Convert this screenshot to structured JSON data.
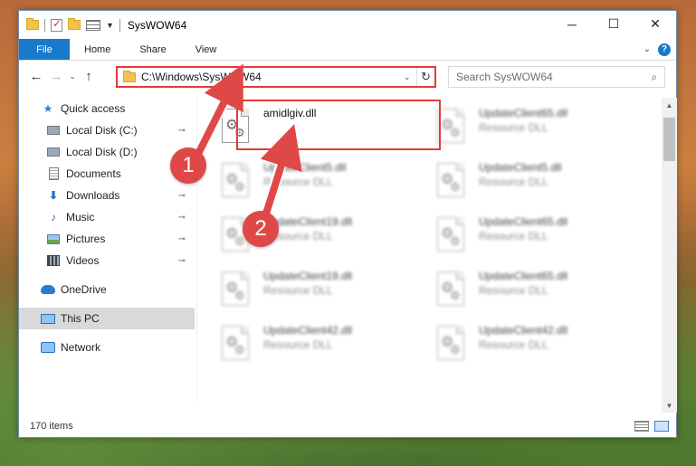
{
  "window": {
    "title": "SysWOW64",
    "controls": {
      "minimize": "─",
      "maximize": "☐",
      "close": "✕"
    }
  },
  "ribbon": {
    "tabs": [
      "File",
      "Home",
      "Share",
      "View"
    ],
    "expand_glyph": "⌄",
    "help_glyph": "?"
  },
  "address": {
    "back": "←",
    "forward": "→",
    "recent": "⌄",
    "up": "↑",
    "path": "C:\\Windows\\SysWOW64",
    "dropdown": "⌄",
    "refresh": "↻",
    "search_placeholder": "Search SysWOW64",
    "search_icon": "⌕"
  },
  "sidebar": {
    "items": [
      {
        "label": "Quick access",
        "icon": "star-icon"
      },
      {
        "label": "Local Disk (C:)",
        "icon": "disk-icon",
        "pinned": true
      },
      {
        "label": "Local Disk (D:)",
        "icon": "disk-icon"
      },
      {
        "label": "Documents",
        "icon": "documents-icon"
      },
      {
        "label": "Downloads",
        "icon": "downloads-icon",
        "pinned": true
      },
      {
        "label": "Music",
        "icon": "music-icon",
        "pinned": true
      },
      {
        "label": "Pictures",
        "icon": "pictures-icon",
        "pinned": true
      },
      {
        "label": "Videos",
        "icon": "videos-icon",
        "pinned": true
      },
      {
        "label": "OneDrive",
        "icon": "onedrive-icon"
      },
      {
        "label": "This PC",
        "icon": "computer-icon",
        "selected": true
      },
      {
        "label": "Network",
        "icon": "network-icon"
      }
    ],
    "pin_glyph": "📌"
  },
  "files": [
    {
      "name": "amidlgiv.dll",
      "type": ""
    },
    {
      "name": "UpdateClient65.dll",
      "type": "Resource DLL"
    },
    {
      "name": "UpdateClient5.dll",
      "type": "Resource DLL"
    },
    {
      "name": "UpdateClient5.dll",
      "type": "Resource DLL"
    },
    {
      "name": "UpdateClient19.dll",
      "type": "Resource DLL"
    },
    {
      "name": "UpdateClient65.dll",
      "type": "Resource DLL"
    },
    {
      "name": "UpdateClient19.dll",
      "type": "Resource DLL"
    },
    {
      "name": "UpdateClient65.dll",
      "type": "Resource DLL"
    },
    {
      "name": "UpdateClient42.dll",
      "type": "Resource DLL"
    },
    {
      "name": "UpdateClient42.dll",
      "type": "Resource DLL"
    }
  ],
  "scrollbar": {
    "up": "▲",
    "down": "▼"
  },
  "status": {
    "item_count": "170 items"
  },
  "annotations": {
    "step1": "1",
    "step2": "2",
    "color": "#e04848"
  }
}
